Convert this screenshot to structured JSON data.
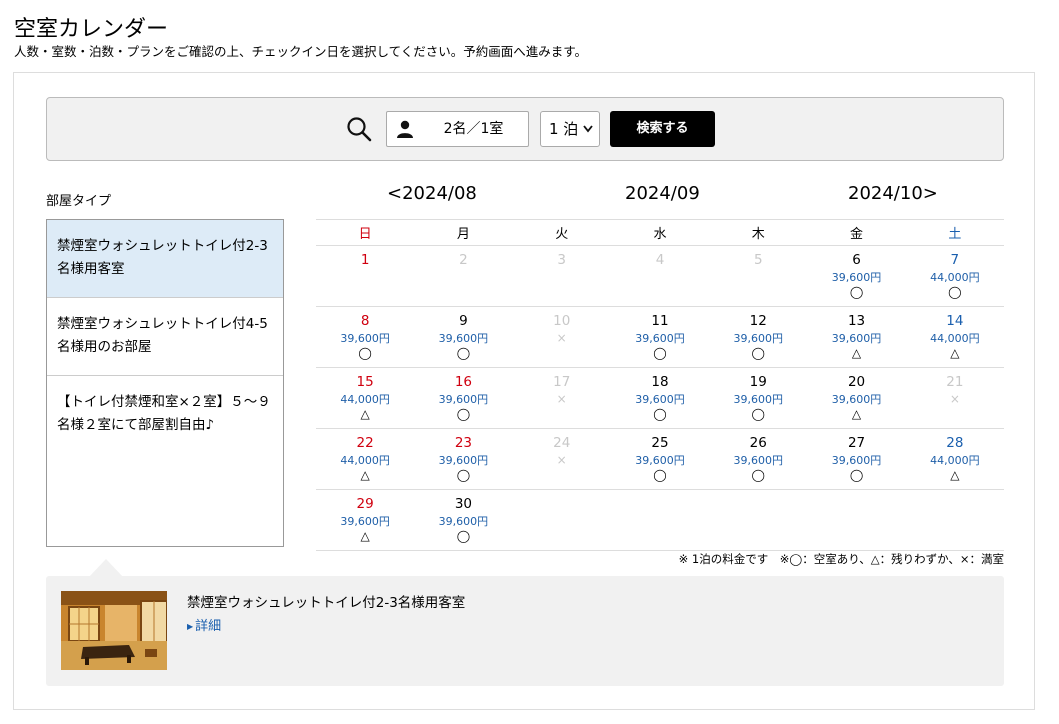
{
  "page": {
    "title": "空室カレンダー",
    "subtitle": "人数・室数・泊数・プランをご確認の上、チェックイン日を選択してください。予約画面へ進みます。"
  },
  "search": {
    "icon": "search-icon",
    "guests_icon": "person-icon",
    "guests_value": "2名／1室",
    "nights_value": "1 泊",
    "nights_chevron": "⌄",
    "button_label": "検索する"
  },
  "room_type": {
    "label": "部屋タイプ",
    "items": [
      {
        "name": "禁煙室ウォシュレットトイレ付2-3名様用客室",
        "selected": true
      },
      {
        "name": "禁煙室ウォシュレットトイレ付4-5名様用のお部屋",
        "selected": false
      },
      {
        "name": "【トイレ付禁煙和室×２室】５〜９名様２室にて部屋割自由♪",
        "selected": false
      }
    ]
  },
  "calendar": {
    "prev_arrow": "<",
    "next_arrow": ">",
    "prev_month": "2024/08",
    "current_month": "2024/09",
    "next_month": "2024/10",
    "weekdays": [
      "日",
      "月",
      "火",
      "水",
      "木",
      "金",
      "土"
    ],
    "weeks": [
      [
        {
          "day": "1",
          "type": "sun",
          "price": "",
          "status": ""
        },
        {
          "day": "2",
          "type": "gray",
          "price": "",
          "status": ""
        },
        {
          "day": "3",
          "type": "gray",
          "price": "",
          "status": ""
        },
        {
          "day": "4",
          "type": "gray",
          "price": "",
          "status": ""
        },
        {
          "day": "5",
          "type": "gray",
          "price": "",
          "status": ""
        },
        {
          "day": "6",
          "type": "normal",
          "price": "39,600円",
          "status": "◯"
        },
        {
          "day": "7",
          "type": "sat",
          "price": "44,000円",
          "status": "◯"
        }
      ],
      [
        {
          "day": "8",
          "type": "sun",
          "price": "39,600円",
          "status": "◯"
        },
        {
          "day": "9",
          "type": "normal",
          "price": "39,600円",
          "status": "◯"
        },
        {
          "day": "10",
          "type": "gray",
          "price": "",
          "status": "×"
        },
        {
          "day": "11",
          "type": "normal",
          "price": "39,600円",
          "status": "◯"
        },
        {
          "day": "12",
          "type": "normal",
          "price": "39,600円",
          "status": "◯"
        },
        {
          "day": "13",
          "type": "normal",
          "price": "39,600円",
          "status": "△"
        },
        {
          "day": "14",
          "type": "sat",
          "price": "44,000円",
          "status": "△"
        }
      ],
      [
        {
          "day": "15",
          "type": "sun",
          "price": "44,000円",
          "status": "△"
        },
        {
          "day": "16",
          "type": "sun",
          "price": "39,600円",
          "status": "◯"
        },
        {
          "day": "17",
          "type": "gray",
          "price": "",
          "status": "×"
        },
        {
          "day": "18",
          "type": "normal",
          "price": "39,600円",
          "status": "◯"
        },
        {
          "day": "19",
          "type": "normal",
          "price": "39,600円",
          "status": "◯"
        },
        {
          "day": "20",
          "type": "normal",
          "price": "39,600円",
          "status": "△"
        },
        {
          "day": "21",
          "type": "gray",
          "price": "",
          "status": "×"
        }
      ],
      [
        {
          "day": "22",
          "type": "sun",
          "price": "44,000円",
          "status": "△"
        },
        {
          "day": "23",
          "type": "sun",
          "price": "39,600円",
          "status": "◯"
        },
        {
          "day": "24",
          "type": "gray",
          "price": "",
          "status": "×"
        },
        {
          "day": "25",
          "type": "normal",
          "price": "39,600円",
          "status": "◯"
        },
        {
          "day": "26",
          "type": "normal",
          "price": "39,600円",
          "status": "◯"
        },
        {
          "day": "27",
          "type": "normal",
          "price": "39,600円",
          "status": "◯"
        },
        {
          "day": "28",
          "type": "sat",
          "price": "44,000円",
          "status": "△"
        }
      ],
      [
        {
          "day": "29",
          "type": "sun",
          "price": "39,600円",
          "status": "△"
        },
        {
          "day": "30",
          "type": "normal",
          "price": "39,600円",
          "status": "◯"
        },
        {
          "day": "",
          "type": "empty",
          "price": "",
          "status": ""
        },
        {
          "day": "",
          "type": "empty",
          "price": "",
          "status": ""
        },
        {
          "day": "",
          "type": "empty",
          "price": "",
          "status": ""
        },
        {
          "day": "",
          "type": "empty",
          "price": "",
          "status": ""
        },
        {
          "day": "",
          "type": "empty",
          "price": "",
          "status": ""
        }
      ]
    ],
    "footnote": "※ 1泊の料金です　※◯：空室あり、△：残りわずか、×：満室",
    "colors": {
      "sunday": "#d0000f",
      "saturday": "#1a5fae",
      "price": "#1f5fa8",
      "disabled": "#c8c8c8"
    }
  },
  "detail": {
    "room_name": "禁煙室ウォシュレットトイレ付2-3名様用客室",
    "link_label": "詳細",
    "link_icon": "triangle-right-icon"
  }
}
